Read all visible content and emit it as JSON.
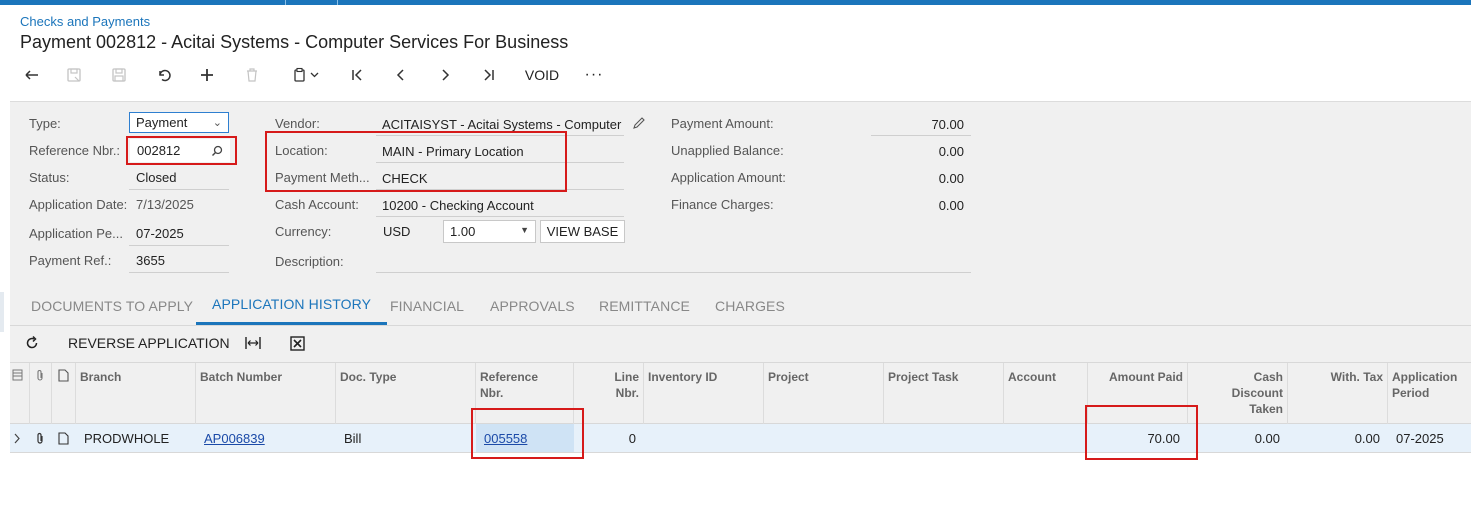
{
  "breadcrumb": "Checks and Payments",
  "page_title": "Payment 002812 - Acitai Systems - Computer Services For Business",
  "toolbar": {
    "void_label": "VOID",
    "more_label": "···"
  },
  "form": {
    "type_label": "Type:",
    "type_value": "Payment",
    "ref_label": "Reference Nbr.:",
    "ref_value": "002812",
    "status_label": "Status:",
    "status_value": "Closed",
    "app_date_label": "Application Date:",
    "app_date_value": "7/13/2025",
    "app_period_label": "Application Pe...",
    "app_period_value": "07-2025",
    "payment_ref_label": "Payment Ref.:",
    "payment_ref_value": "3655",
    "vendor_label": "Vendor:",
    "vendor_value": "ACITAISYST - Acitai Systems - Computer",
    "location_label": "Location:",
    "location_value": "MAIN - Primary Location",
    "payment_method_label": "Payment Meth...",
    "payment_method_value": "CHECK",
    "cash_account_label": "Cash Account:",
    "cash_account_value": "10200 - Checking Account",
    "currency_label": "Currency:",
    "currency_value": "USD",
    "currency_rate": "1.00",
    "view_base_label": "VIEW BASE",
    "description_label": "Description:",
    "payment_amount_label": "Payment Amount:",
    "payment_amount_value": "70.00",
    "unapplied_label": "Unapplied Balance:",
    "unapplied_value": "0.00",
    "application_amount_label": "Application Amount:",
    "application_amount_value": "0.00",
    "finance_charges_label": "Finance Charges:",
    "finance_charges_value": "0.00"
  },
  "tabs": [
    {
      "label": "DOCUMENTS TO APPLY"
    },
    {
      "label": "APPLICATION HISTORY"
    },
    {
      "label": "FINANCIAL"
    },
    {
      "label": "APPROVALS"
    },
    {
      "label": "REMITTANCE"
    },
    {
      "label": "CHARGES"
    }
  ],
  "grid_toolbar": {
    "reverse_label": "REVERSE APPLICATION"
  },
  "grid": {
    "headers": {
      "branch": "Branch",
      "batch_number": "Batch Number",
      "doc_type": "Doc. Type",
      "reference_nbr_1": "Reference",
      "reference_nbr_2": "Nbr.",
      "line_nbr_1": "Line",
      "line_nbr_2": "Nbr.",
      "inventory_id": "Inventory ID",
      "project": "Project",
      "project_task": "Project Task",
      "account": "Account",
      "amount_paid": "Amount Paid",
      "cash_discount_1": "Cash",
      "cash_discount_2": "Discount",
      "cash_discount_3": "Taken",
      "with_tax": "With. Tax",
      "app_period_1": "Application",
      "app_period_2": "Period"
    },
    "rows": [
      {
        "branch": "PRODWHOLE",
        "batch_number": "AP006839",
        "doc_type": "Bill",
        "reference_nbr": "005558",
        "line_nbr": "0",
        "amount_paid": "70.00",
        "cash_discount": "0.00",
        "with_tax": "0.00",
        "app_period": "07-2025"
      }
    ]
  },
  "colors": {
    "accent": "#1b75bb",
    "highlight_box": "#d61a1a",
    "row_selected": "#e7f1fa"
  },
  "icons": [
    "back-icon",
    "save-close-icon",
    "save-icon",
    "undo-icon",
    "add-icon",
    "delete-icon",
    "copy-paste-icon",
    "first-icon",
    "prev-icon",
    "next-icon",
    "last-icon",
    "search-icon",
    "pencil-icon",
    "refresh-icon",
    "fit-columns-icon",
    "excel-export-icon"
  ]
}
